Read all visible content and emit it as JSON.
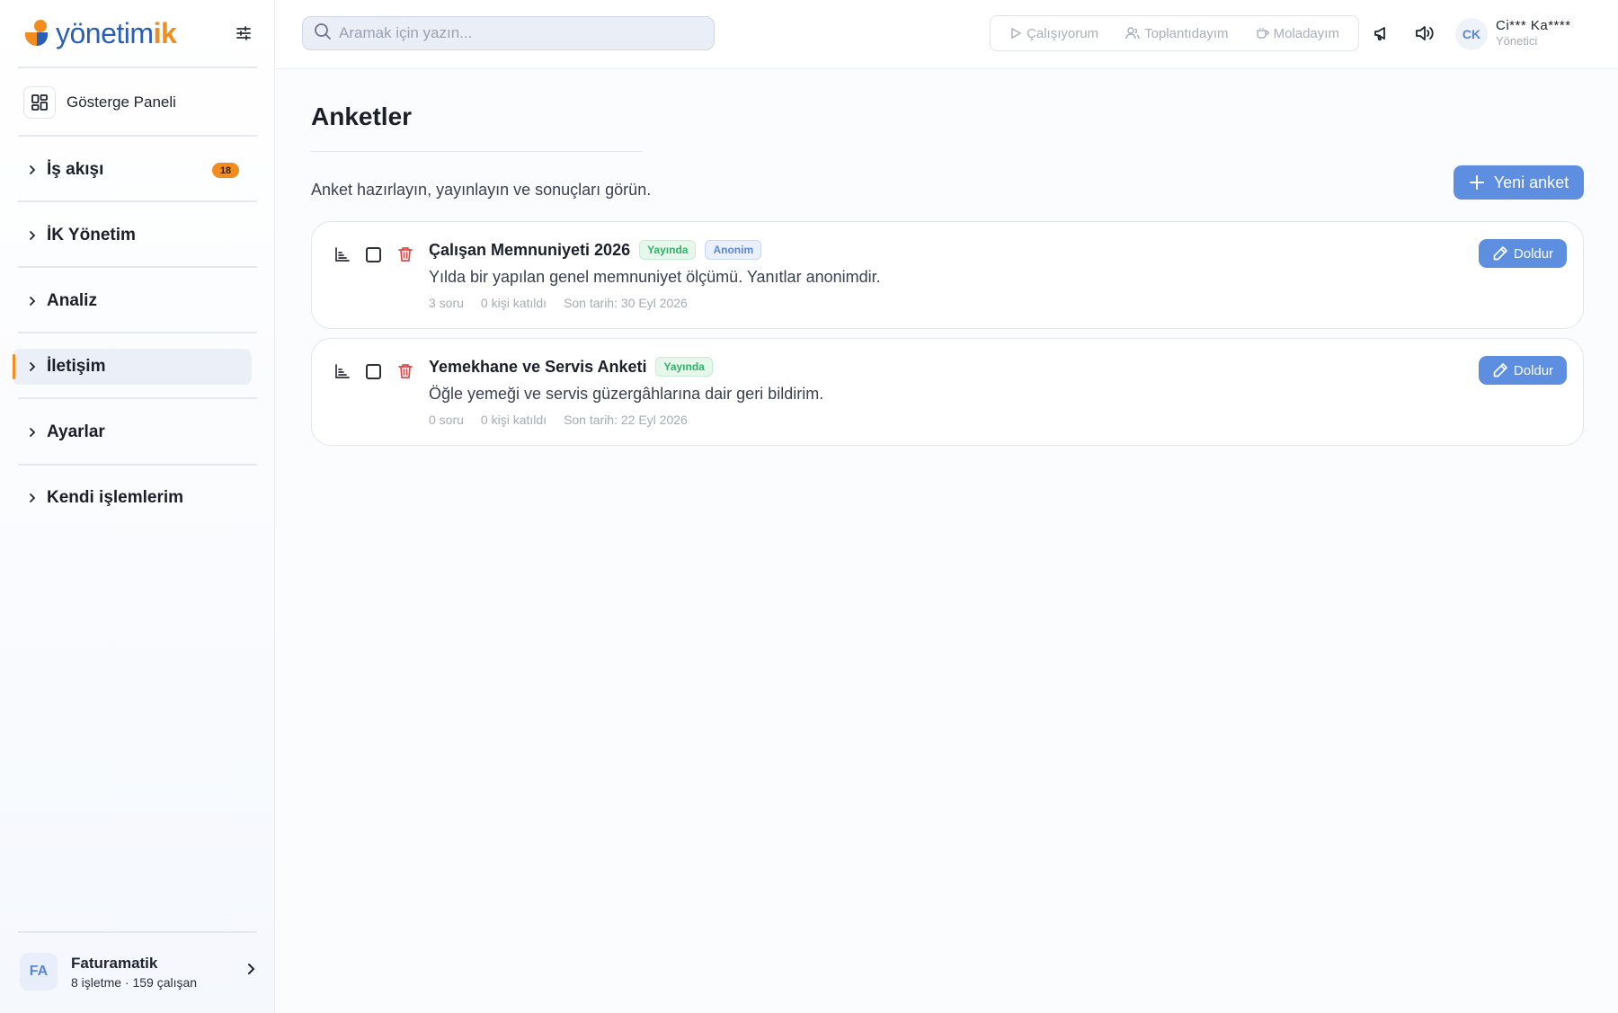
{
  "app": {
    "logo_text_main": "yönetim",
    "logo_text_accent": "ik",
    "brand_blue": "#2a5fb8",
    "brand_orange": "#f28c1f",
    "accent_button": "#5d8ee0"
  },
  "sidebar": {
    "dashboard_label": "Gösterge Paneli",
    "items": [
      {
        "label": "İş akışı",
        "badge": "18"
      },
      {
        "label": "İK Yönetim"
      },
      {
        "label": "Analiz"
      },
      {
        "label": "İletişim",
        "active": true
      },
      {
        "label": "Ayarlar"
      },
      {
        "label": "Kendi işlemlerim"
      }
    ],
    "org": {
      "initials": "FA",
      "name": "Faturamatik",
      "subtitle": "8 işletme · 159 çalışan"
    }
  },
  "topbar": {
    "search_placeholder": "Aramak için yazın...",
    "status": {
      "working": "Çalışıyorum",
      "meeting": "Toplantıdayım",
      "break": "Moladayım"
    },
    "user": {
      "initials": "CK",
      "name": "Ci*** Ka****",
      "role": "Yönetici"
    }
  },
  "main": {
    "title": "Anketler",
    "subtitle": "Anket hazırlayın, yayınlayın ve sonuçları görün.",
    "new_button": "Yeni anket",
    "surveys": [
      {
        "title": "Çalışan Memnuniyeti 2026",
        "status_tag": "Yayında",
        "anon_tag": "Anonim",
        "description": "Yılda bir yapılan genel memnuniyet ölçümü. Yanıtlar anonimdir.",
        "questions": "3 soru",
        "participants": "0 kişi katıldı",
        "deadline": "Son tarih: 30 Eyl 2026",
        "fill_label": "Doldur"
      },
      {
        "title": "Yemekhane ve Servis Anketi",
        "status_tag": "Yayında",
        "description": "Öğle yemeği ve servis güzergâhlarına dair geri bildirim.",
        "questions": "0 soru",
        "participants": "0 kişi katıldı",
        "deadline": "Son tarih: 22 Eyl 2026",
        "fill_label": "Doldur"
      }
    ]
  }
}
